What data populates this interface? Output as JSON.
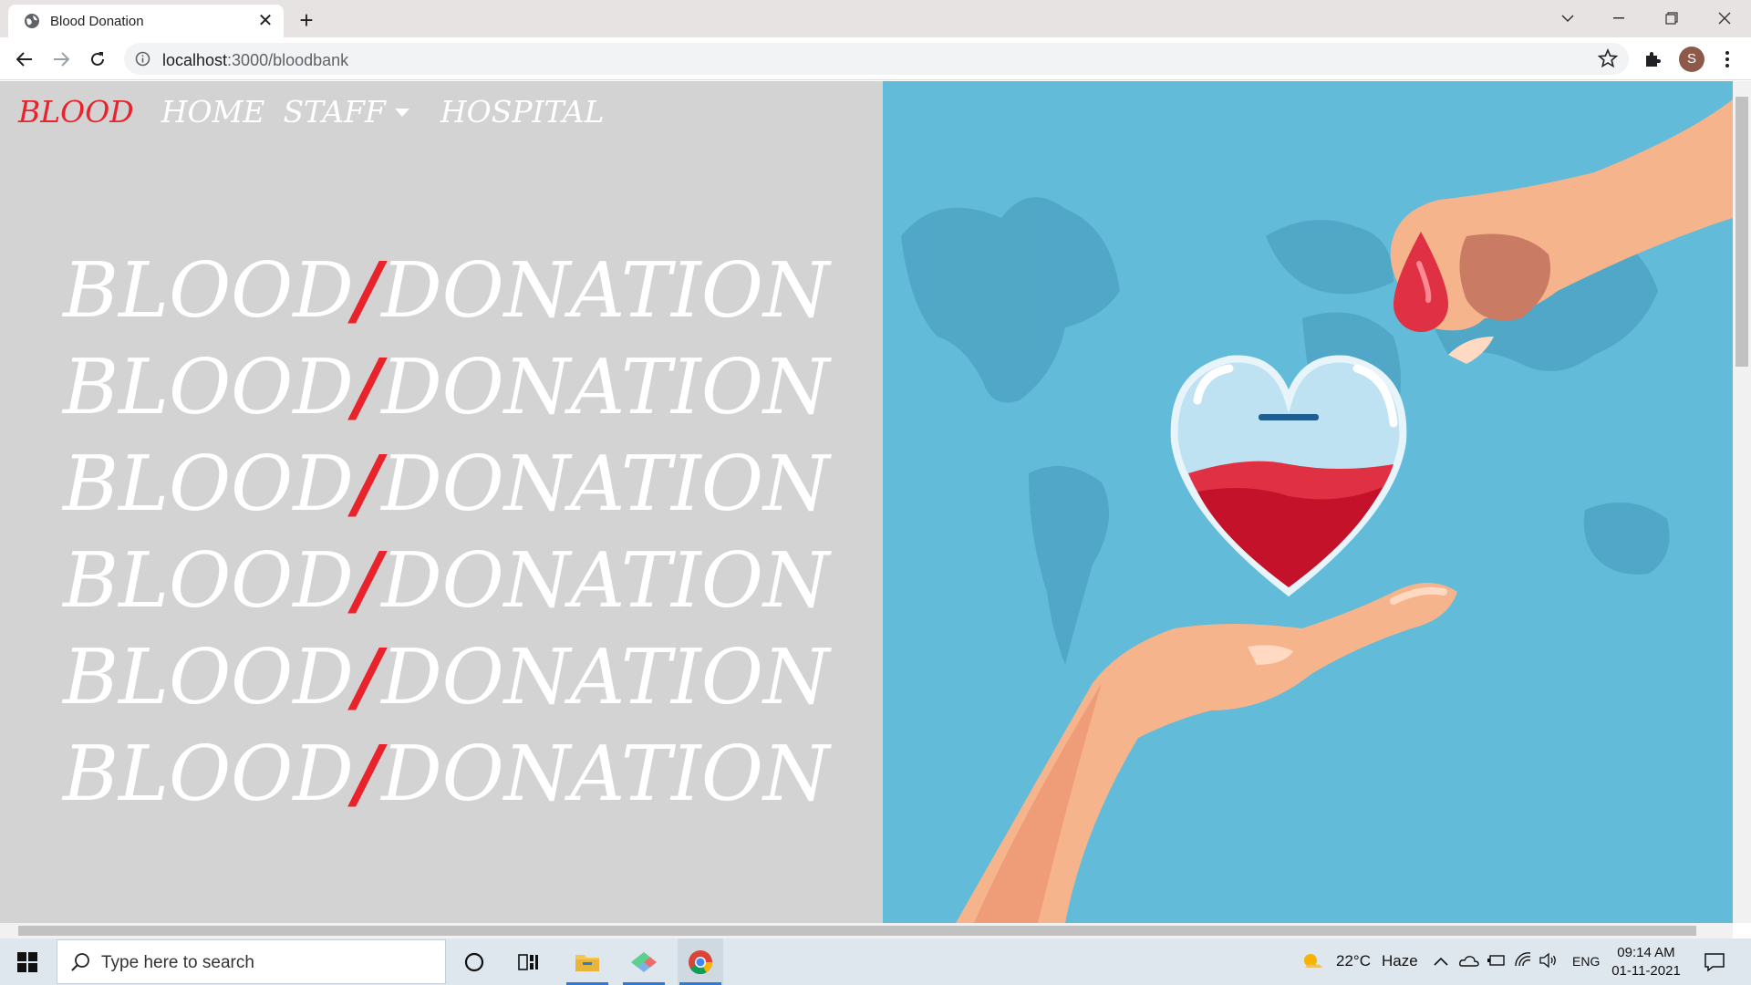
{
  "browser": {
    "tab_title": "Blood Donation",
    "url_host": "localhost",
    "url_path": ":3000/bloodbank",
    "profile_initial": "S"
  },
  "site": {
    "brand": "BLOOD",
    "nav": {
      "home": "HOME",
      "staff": "STAFF",
      "hospital": "HOSPITAL"
    },
    "hero_word_left": "BLOOD",
    "hero_separator": "/",
    "hero_word_right": "DONATION",
    "hero_lines": 6,
    "colors": {
      "accent": "#e8232c",
      "page_bg": "#d3d3d3",
      "illustration_bg": "#62bbd9"
    }
  },
  "taskbar": {
    "search_placeholder": "Type here to search",
    "weather_temp": "22°C",
    "weather_desc": "Haze",
    "language": "ENG",
    "time": "09:14 AM",
    "date": "01-11-2021"
  },
  "icons": [
    "globe-icon",
    "close-icon",
    "plus-icon",
    "chevron-down-icon",
    "minimize-icon",
    "maximize-icon",
    "back-icon",
    "forward-icon",
    "reload-icon",
    "info-icon",
    "star-icon",
    "puzzle-icon",
    "kebab-icon",
    "windows-icon",
    "search-icon",
    "cortana-icon",
    "task-view-icon",
    "file-explorer-icon",
    "app-icon",
    "chrome-icon",
    "weather-icon",
    "onedrive-icon",
    "battery-icon",
    "wifi-icon",
    "volume-icon",
    "notification-icon"
  ]
}
